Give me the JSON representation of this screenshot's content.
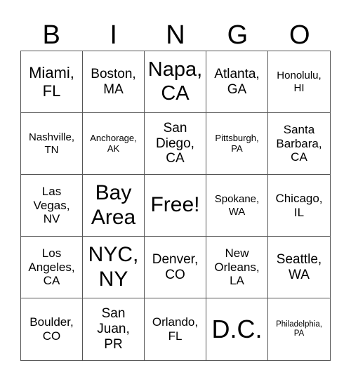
{
  "header": {
    "letters": [
      "B",
      "I",
      "N",
      "G",
      "O"
    ]
  },
  "cells": [
    [
      "Miami,\nFL",
      "Boston,\nMA",
      "Napa,\nCA",
      "Atlanta,\nGA",
      "Honolulu,\nHI"
    ],
    [
      "Nashville,\nTN",
      "Anchorage,\nAK",
      "San\nDiego,\nCA",
      "Pittsburgh,\nPA",
      "Santa\nBarbara,\nCA"
    ],
    [
      "Las\nVegas,\nNV",
      "Bay\nArea",
      "Free!",
      "Spokane,\nWA",
      "Chicago,\nIL"
    ],
    [
      "Los\nAngeles,\nCA",
      "NYC,\nNY",
      "Denver,\nCO",
      "New\nOrleans,\nLA",
      "Seattle,\nWA"
    ],
    [
      "Boulder,\nCO",
      "San\nJuan,\nPR",
      "Orlando,\nFL",
      "D.C.",
      "Philadelphia,\nPA"
    ]
  ]
}
